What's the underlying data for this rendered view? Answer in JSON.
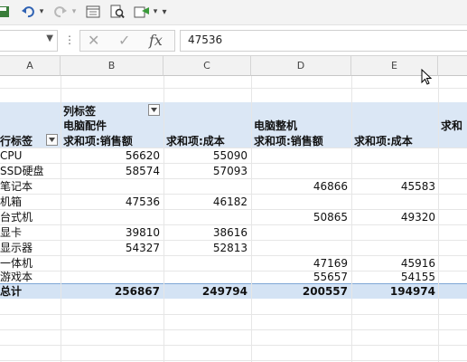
{
  "formula": {
    "value": "47536",
    "fx_label": "fx",
    "more": "⋮"
  },
  "columns": [
    "A",
    "B",
    "C",
    "D",
    "E"
  ],
  "pivot": {
    "col_label": "列标签",
    "row_label": "行标签",
    "groups": [
      "电脑配件",
      "电脑整机",
      "求和"
    ],
    "measures": [
      "求和项:销售额",
      "求和项:成本",
      "求和项:销售额",
      "求和项:成本"
    ],
    "rows": [
      {
        "label": "CPU",
        "v": [
          "56620",
          "55090",
          "",
          ""
        ]
      },
      {
        "label": "SSD硬盘",
        "v": [
          "58574",
          "57093",
          "",
          ""
        ]
      },
      {
        "label": "笔记本",
        "v": [
          "",
          "",
          "46866",
          "45583"
        ]
      },
      {
        "label": "机箱",
        "v": [
          "47536",
          "46182",
          "",
          ""
        ]
      },
      {
        "label": "台式机",
        "v": [
          "",
          "",
          "50865",
          "49320"
        ]
      },
      {
        "label": "显卡",
        "v": [
          "39810",
          "38616",
          "",
          ""
        ]
      },
      {
        "label": "显示器",
        "v": [
          "54327",
          "52813",
          "",
          ""
        ]
      },
      {
        "label": "一体机",
        "v": [
          "",
          "",
          "47169",
          "45916"
        ]
      },
      {
        "label": "游戏本",
        "v": [
          "",
          "",
          "55657",
          "54155"
        ]
      }
    ],
    "total": {
      "label": "总计",
      "v": [
        "256867",
        "249794",
        "200557",
        "194974"
      ]
    }
  }
}
